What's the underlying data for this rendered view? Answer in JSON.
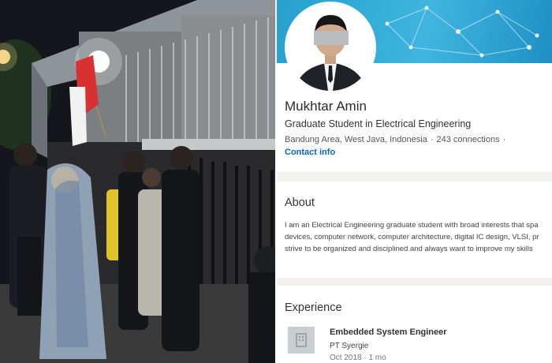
{
  "profile": {
    "name": "Mukhtar Amin",
    "headline": "Graduate Student in Electrical Engineering",
    "location": "Bandung Area, West Java, Indonesia",
    "location_sep": "·",
    "connections": "243 connections",
    "trailing_sep": "·",
    "contact_info": "Contact info"
  },
  "about": {
    "title": "About",
    "lines": [
      "I am an Electrical Engineering graduate student with broad interests that spa",
      "devices, computer network, computer architecture, digital IC design, VLSI, pr",
      "strive to be organized and disciplined and always want to improve my skills"
    ]
  },
  "experience": {
    "title": "Experience",
    "items": [
      {
        "title": "Embedded System Engineer",
        "company": "PT Syergie",
        "dates": "Oct 2018 · 1 mo"
      }
    ]
  },
  "colors": {
    "banner": "#27a0cf",
    "link": "#0a66c2",
    "page_bg": "#f3f2ef"
  }
}
